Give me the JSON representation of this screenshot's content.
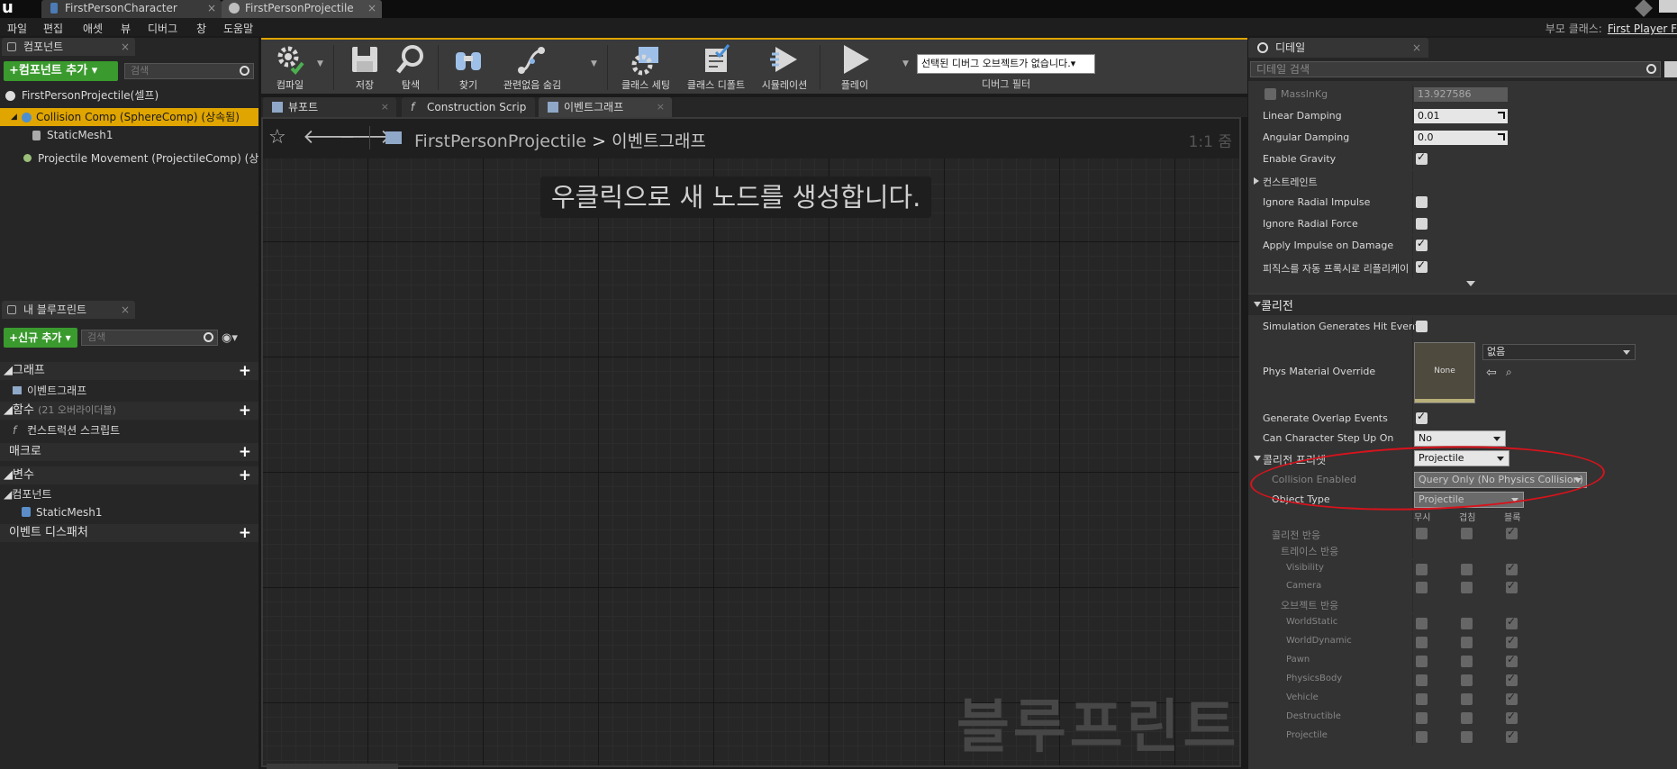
{
  "window": {
    "tabs": [
      {
        "label": "FirstPersonCharacter"
      },
      {
        "label": "FirstPersonProjectile"
      }
    ]
  },
  "menu": [
    "파일",
    "편집",
    "애셋",
    "뷰",
    "디버그",
    "창",
    "도움말"
  ],
  "parent_class": {
    "label": "부모 클래스:",
    "value": "First Player F"
  },
  "components": {
    "tab_label": "컴포넌트",
    "add_button": "+컴포넌트 추가 ▾",
    "search_placeholder": "검색",
    "tree": [
      {
        "label": "FirstPersonProjectile(셀프)"
      },
      {
        "label": "Collision Comp (SphereComp) (상속됨)"
      },
      {
        "label": "StaticMesh1"
      },
      {
        "label": "Projectile Movement (ProjectileComp) (상속됨)"
      }
    ]
  },
  "my_blueprint": {
    "tab_label": "내 블루프린트",
    "add_button": "+신규 추가 ▾",
    "search_placeholder": "검색",
    "categories": {
      "graphs": "그래프",
      "event_graph": "이벤트그래프",
      "functions": "함수",
      "functions_sub": "(21 오버라이더블)",
      "construction_script": "컨스트럭션 스크립트",
      "macros": "매크로",
      "variables": "변수",
      "components": "컴포넌트",
      "static_mesh": "StaticMesh1",
      "event_dispatchers": "이벤트 디스패처"
    }
  },
  "toolbar": {
    "compile": "컴파일",
    "save": "저장",
    "browse": "탐색",
    "find": "찾기",
    "hide_unrelated": "관련없음 숨김",
    "class_settings": "클래스 세팅",
    "class_defaults": "클래스 디폴트",
    "simulation": "시뮬레이션",
    "play": "플레이",
    "debug_object": "선택된 디버그 오브젝트가 없습니다.",
    "debug_filter": "디버그 필터"
  },
  "editor_tabs": [
    {
      "label": "뷰포트"
    },
    {
      "label": "Construction Scrip"
    },
    {
      "label": "이벤트그래프"
    }
  ],
  "graph": {
    "breadcrumb_blueprint": "FirstPersonProjectile",
    "breadcrumb_sep": ">",
    "breadcrumb_graph": "이벤트그래프",
    "zoom": "1:1 줌",
    "hint": "우클릭으로 새 노드를 생성합니다.",
    "watermark": "블루프린트"
  },
  "details": {
    "tab_label": "디테일",
    "search_placeholder": "디테일 검색",
    "mass_in_kg": {
      "label": "MassInKg",
      "value": "13.927586"
    },
    "linear_damping": {
      "label": "Linear Damping",
      "value": "0.01"
    },
    "angular_damping": {
      "label": "Angular Damping",
      "value": "0.0"
    },
    "enable_gravity": {
      "label": "Enable Gravity",
      "checked": true
    },
    "constraints": "컨스트레인트",
    "ignore_radial_impulse": {
      "label": "Ignore Radial Impulse",
      "checked": false
    },
    "ignore_radial_force": {
      "label": "Ignore Radial Force",
      "checked": false
    },
    "apply_impulse_on_damage": {
      "label": "Apply Impulse on Damage",
      "checked": true
    },
    "auto_physics": {
      "label": "피직스를 자동 프록시로 리플리케이트",
      "checked": true
    },
    "collision_section": "콜리전",
    "sim_hit_events": {
      "label": "Simulation Generates Hit Events",
      "checked": false
    },
    "phys_material": {
      "label": "Phys Material Override",
      "thumb": "None",
      "value": "없음"
    },
    "overlap_events": {
      "label": "Generate Overlap Events",
      "checked": true
    },
    "step_up": {
      "label": "Can Character Step Up On",
      "value": "No"
    },
    "collision_presets": {
      "label": "콜리전 프리셋",
      "value": "Projectile"
    },
    "collision_enabled": {
      "label": "Collision Enabled",
      "value": "Query Only (No Physics Collision)"
    },
    "object_type": {
      "label": "Object Type",
      "value": "Projectile"
    },
    "response_cols": [
      "무시",
      "겹침",
      "블록"
    ],
    "collision_responses": "콜리전 반응",
    "trace_responses": "트레이스 반응",
    "object_responses": "오브젝트 반응",
    "rows": [
      {
        "label": "Visibility"
      },
      {
        "label": "Camera"
      },
      {
        "label": "WorldStatic"
      },
      {
        "label": "WorldDynamic"
      },
      {
        "label": "Pawn"
      },
      {
        "label": "PhysicsBody"
      },
      {
        "label": "Vehicle"
      },
      {
        "label": "Destructible"
      },
      {
        "label": "Projectile"
      }
    ]
  },
  "colors": {
    "accent": "#e0a500",
    "add_green": "#3a9a2e",
    "annotation_red": "#d8131c"
  }
}
